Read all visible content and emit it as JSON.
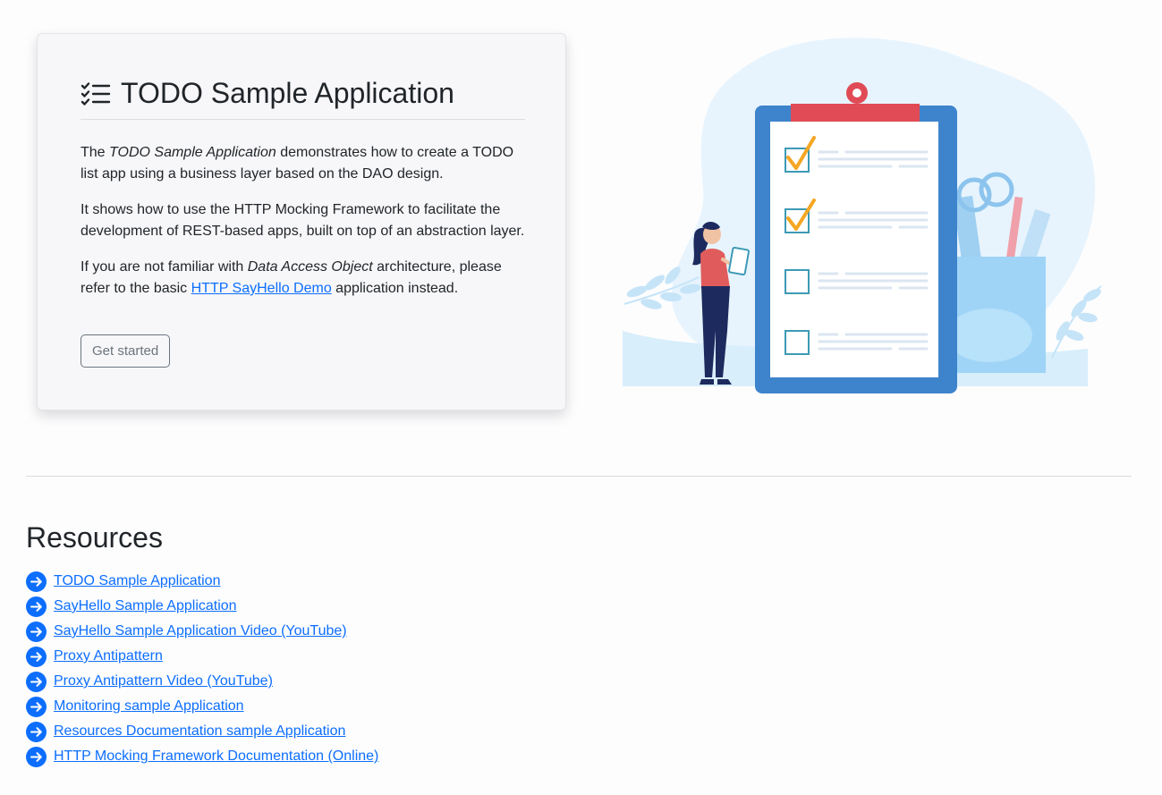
{
  "hero": {
    "title": "TODO Sample Application",
    "title_icon": "list-check-icon",
    "p1": {
      "text_1": "The ",
      "emphasis": "TODO Sample Application",
      "text_2": " demonstrates how to create a TODO list app using a business layer based on the DAO design."
    },
    "p2": {
      "text": "It shows how to use the HTTP Mocking Framework to facilitate the development of REST-based apps, built on top of an abstraction layer."
    },
    "p3": {
      "text_1": "If you are not familiar with ",
      "emphasis": "Data Access Object",
      "text_2": " architecture, please refer to the basic ",
      "link": "HTTP SayHello Demo",
      "text_3": " application instead."
    },
    "button_label": "Get started"
  },
  "illustration": {
    "icon": "clipboard-checklist-illustration"
  },
  "resources": {
    "heading": "Resources",
    "item_icon": "arrow-right-circle-icon",
    "items": [
      "TODO Sample Application",
      "SayHello Sample Application",
      "SayHello Sample Application Video (YouTube)",
      "Proxy Antipattern",
      "Proxy Antipattern Video (YouTube)",
      "Monitoring sample Application",
      "Resources Documentation sample Application",
      "HTTP Mocking Framework Documentation (Online)"
    ]
  },
  "colors": {
    "link": "#0d6efd",
    "card_background": "#f7f7f9",
    "button_border": "#6c757d",
    "clipboard_frame": "#3d84cc",
    "clipboard_clip": "#e04b55",
    "check_mark": "#f5a623"
  }
}
